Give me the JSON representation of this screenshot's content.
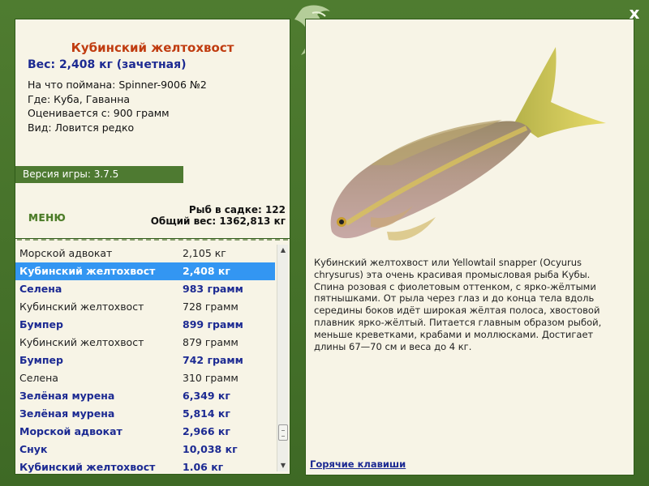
{
  "window": {
    "close_label": "x"
  },
  "info": {
    "title": "Кубинский желтохвост",
    "weight": "Вес: 2,408 кг (зачетная)",
    "caught_on": "На что поймана: Spinner-9006 №2",
    "location": "Где: Куба, Гаванна",
    "min_weight": "Оценивается с: 900 грамм",
    "rarity": "Вид: Ловится редко"
  },
  "version": "Версия игры: 3.7.5",
  "menu_label": "МЕНЮ",
  "stats": {
    "fish_count": "Рыб в садке: 122",
    "total_weight": "Общий вес: 1362,813 кг"
  },
  "catch_list": [
    {
      "name": "Морской адвокат",
      "weight": "2,105 кг",
      "bold": false,
      "selected": false
    },
    {
      "name": "Кубинский желтохвост",
      "weight": "2,408 кг",
      "bold": true,
      "selected": true
    },
    {
      "name": "Селена",
      "weight": "983 грамм",
      "bold": true,
      "selected": false
    },
    {
      "name": "Кубинский желтохвост",
      "weight": "728 грамм",
      "bold": false,
      "selected": false
    },
    {
      "name": "Бумпер",
      "weight": "899 грамм",
      "bold": true,
      "selected": false
    },
    {
      "name": "Кубинский желтохвост",
      "weight": "879 грамм",
      "bold": false,
      "selected": false
    },
    {
      "name": "Бумпер",
      "weight": "742 грамм",
      "bold": true,
      "selected": false
    },
    {
      "name": "Селена",
      "weight": "310 грамм",
      "bold": false,
      "selected": false
    },
    {
      "name": "Зелёная мурена",
      "weight": "6,349 кг",
      "bold": true,
      "selected": false
    },
    {
      "name": "Зелёная мурена",
      "weight": "5,814 кг",
      "bold": true,
      "selected": false
    },
    {
      "name": "Морской адвокат",
      "weight": "2,966 кг",
      "bold": true,
      "selected": false
    },
    {
      "name": "Снук",
      "weight": "10,038 кг",
      "bold": true,
      "selected": false
    },
    {
      "name": "Кубинский желтохвост",
      "weight": "1.06 кг",
      "bold": true,
      "selected": false
    }
  ],
  "description": "Кубинский желтохвост или Yellowtail snapper (Ocyurus chrysurus) эта очень красивая промысловая рыба Кубы. Спина розовая с фиолетовым оттенком, с ярко-жёлтыми пятнышками. От рыла через глаз и до конца тела вдоль середины боков идёт широкая жёлтая полоса, хвостовой плавник ярко-жёлтый. Питается главным образом рыбой, меньше креветками, крабами и моллюсками. Достигает длины 67—70 см и веса до 4 кг.",
  "hotkeys_label": "Горячие клавиши",
  "colors": {
    "frame_green": "#4d7a2e",
    "panel_bg": "#f7f4e6",
    "title_orange": "#c03c10",
    "text_blue": "#1c2a92",
    "selection_blue": "#3396f2"
  }
}
